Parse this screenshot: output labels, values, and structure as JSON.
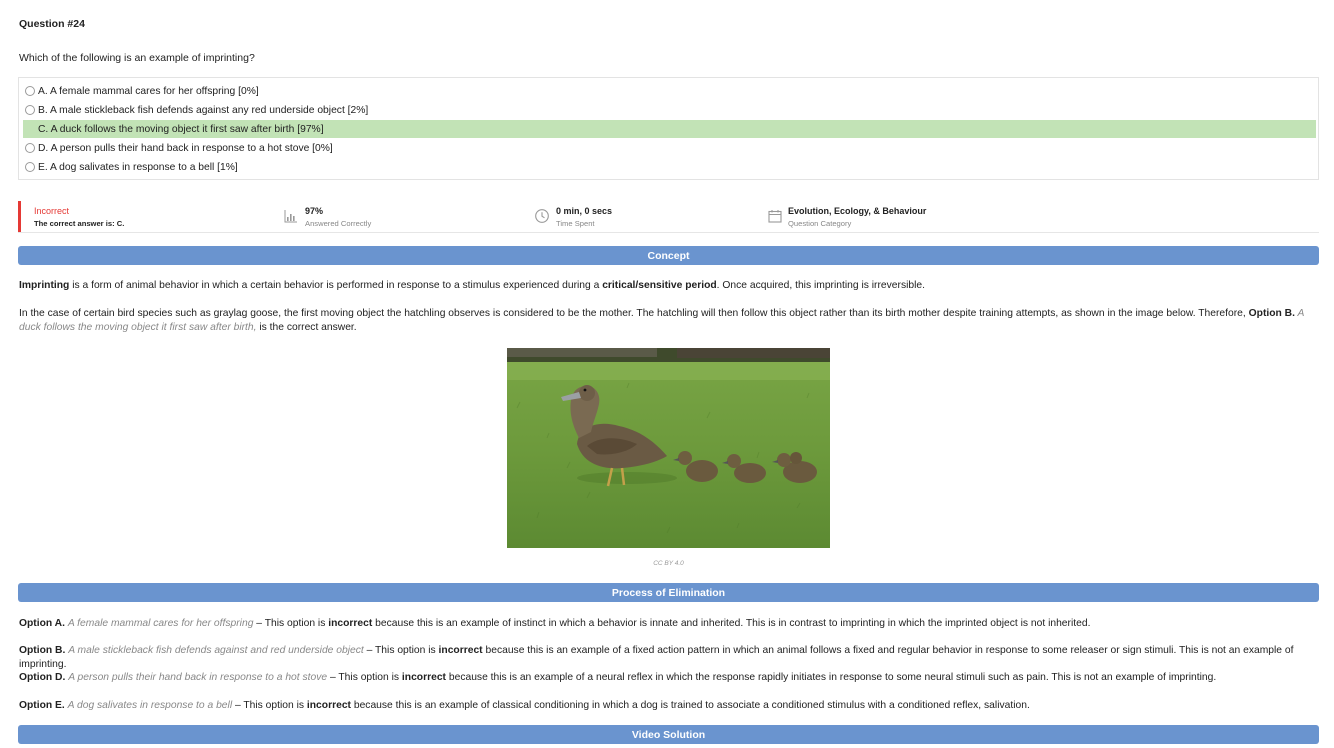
{
  "question": {
    "title": "Question #24",
    "text": "Which of the following is an example of imprinting?"
  },
  "options": [
    {
      "label": "A. A female mammal cares for her offspring [0%]",
      "correct": false
    },
    {
      "label": "B. A male stickleback fish defends against any red underside object [2%]",
      "correct": false
    },
    {
      "label": "C. A duck follows the moving object it first saw after birth [97%]",
      "correct": true
    },
    {
      "label": "D. A person pulls their hand back in response to a hot stove [0%]",
      "correct": false
    },
    {
      "label": "E. A dog salivates in response to a bell [1%]",
      "correct": false
    }
  ],
  "stats": {
    "result": "Incorrect",
    "result_sub": "The correct answer is: C.",
    "percent": "97%",
    "percent_sub": "Answered Correctly",
    "time": "0 min, 0 secs",
    "time_sub": "Time Spent",
    "category": "Evolution, Ecology, & Behaviour",
    "category_sub": "Question Category",
    "status_color": "#e53935"
  },
  "sections": {
    "concept": "Concept",
    "elimination": "Process of Elimination",
    "video": "Video Solution"
  },
  "concept": {
    "p1_term": "Imprinting",
    "p1_a": " is a form of animal behavior in which a certain behavior is performed in response to a stimulus experienced during a ",
    "p1_bold": "critical/sensitive period",
    "p1_b": ". Once acquired, this imprinting is irreversible.",
    "p2_a": "In the case of certain bird species such as graylag goose, the first moving object the hatchling observes is considered to be the mother. The hatchling will then follow this object rather than its birth mother despite training attempts, as shown in the image below. Therefore, ",
    "p2_option": "Option B.",
    "p2_italic": " A duck follows the moving object it first saw after birth,",
    "p2_b": " is the correct answer.",
    "image_caption": "CC BY 4.0"
  },
  "elimination": [
    {
      "option": "Option A.",
      "italic": "A female mammal cares for her offspring",
      "pre": " – This option is ",
      "bold": "incorrect",
      "post": " because this is an example of instinct in which a behavior is innate and inherited. This is in contrast to imprinting in which the imprinted object is not inherited."
    },
    {
      "option": "Option B.",
      "italic": "A male stickleback fish defends against and red underside object",
      "pre": " – This option is ",
      "bold": "incorrect",
      "post": " because this is an example of a fixed action pattern in which an animal follows a fixed and regular behavior in response to some releaser or sign stimuli. This is not an example of imprinting."
    },
    {
      "option": "Option D.",
      "italic": "A person pulls their hand back in response to a hot stove",
      "pre": " – This option is ",
      "bold": "incorrect",
      "post": " because this is an example of a neural reflex in which the response rapidly initiates in response to some neural stimuli such as pain. This is not an example of imprinting."
    },
    {
      "option": "Option E.",
      "italic": "A dog salivates in response to a bell",
      "pre": " – This option is ",
      "bold": "incorrect",
      "post": " because this is an example of classical conditioning in which a dog is trained to associate a conditioned stimulus with a conditioned reflex, salivation."
    }
  ],
  "colors": {
    "band": "#6a94cf",
    "correct_highlight": "#c2e3b6"
  }
}
